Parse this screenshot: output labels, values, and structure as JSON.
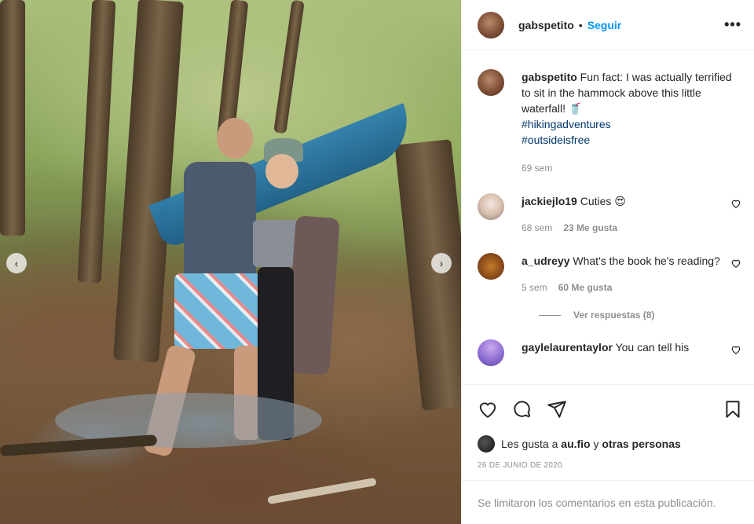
{
  "header": {
    "username": "gabspetito",
    "separator": "•",
    "follow_label": "Seguir",
    "more_label": "•••"
  },
  "photo": {
    "prev_arrow": "‹",
    "next_arrow": "›"
  },
  "caption": {
    "username": "gabspetito",
    "text": "Fun fact: I was actually terrified to sit in the hammock above this little waterfall! 🥤",
    "hashtags": [
      "#hikingadventures",
      "#outsideisfree"
    ],
    "time": "69 sem"
  },
  "comments": [
    {
      "username": "jackiejlo19",
      "text": "Cuties 😍",
      "time": "68 sem",
      "likes": "23 Me gusta"
    },
    {
      "username": "a_udreyy",
      "text": "What's the book he's reading?",
      "time": "5 sem",
      "likes": "60 Me gusta",
      "replies": "Ver respuestas (8)"
    },
    {
      "username": "gaylelaurentaylor",
      "text": "You can tell his"
    }
  ],
  "actions": {
    "like_icon": "heart-icon",
    "comment_icon": "comment-icon",
    "share_icon": "share-icon",
    "save_icon": "bookmark-icon"
  },
  "likes_summary": {
    "prefix": "Les gusta a",
    "user": "au.fio",
    "connector": "y",
    "others": "otras personas"
  },
  "date": "26 DE JUNIO DE 2020",
  "comments_limited": "Se limitaron los comentarios en esta publicación."
}
